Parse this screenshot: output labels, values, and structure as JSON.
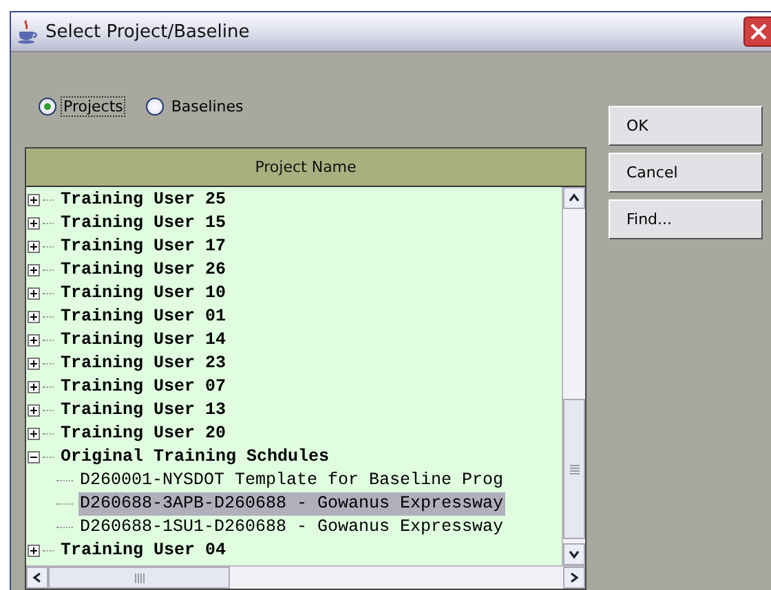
{
  "window": {
    "title": "Select Project/Baseline"
  },
  "mode_options": [
    {
      "label": "Projects",
      "selected": true
    },
    {
      "label": "Baselines",
      "selected": false
    }
  ],
  "tree": {
    "column_header": "Project Name",
    "items": [
      {
        "label": "Training User 25",
        "expanded": false,
        "selected": false
      },
      {
        "label": "Training User 15",
        "expanded": false,
        "selected": false
      },
      {
        "label": "Training User 17",
        "expanded": false,
        "selected": false
      },
      {
        "label": "Training User 26",
        "expanded": false,
        "selected": false
      },
      {
        "label": "Training User 10",
        "expanded": false,
        "selected": false
      },
      {
        "label": "Training User 01",
        "expanded": false,
        "selected": false
      },
      {
        "label": "Training User 14",
        "expanded": false,
        "selected": false
      },
      {
        "label": "Training User 23",
        "expanded": false,
        "selected": false
      },
      {
        "label": "Training User 07",
        "expanded": false,
        "selected": false
      },
      {
        "label": "Training User 13",
        "expanded": false,
        "selected": false
      },
      {
        "label": "Training User 20",
        "expanded": false,
        "selected": false
      },
      {
        "label": "Original Training Schdules",
        "expanded": true,
        "selected": false,
        "children": [
          {
            "label": "D260001-NYSDOT Template for Baseline Prog",
            "selected": false
          },
          {
            "label": "D260688-3APB-D260688 - Gowanus Expressway",
            "selected": true
          },
          {
            "label": "D260688-1SU1-D260688 - Gowanus Expressway",
            "selected": false
          }
        ]
      },
      {
        "label": "Training User 04",
        "expanded": false,
        "selected": false
      }
    ]
  },
  "buttons": [
    "OK",
    "Cancel",
    "Find..."
  ]
}
